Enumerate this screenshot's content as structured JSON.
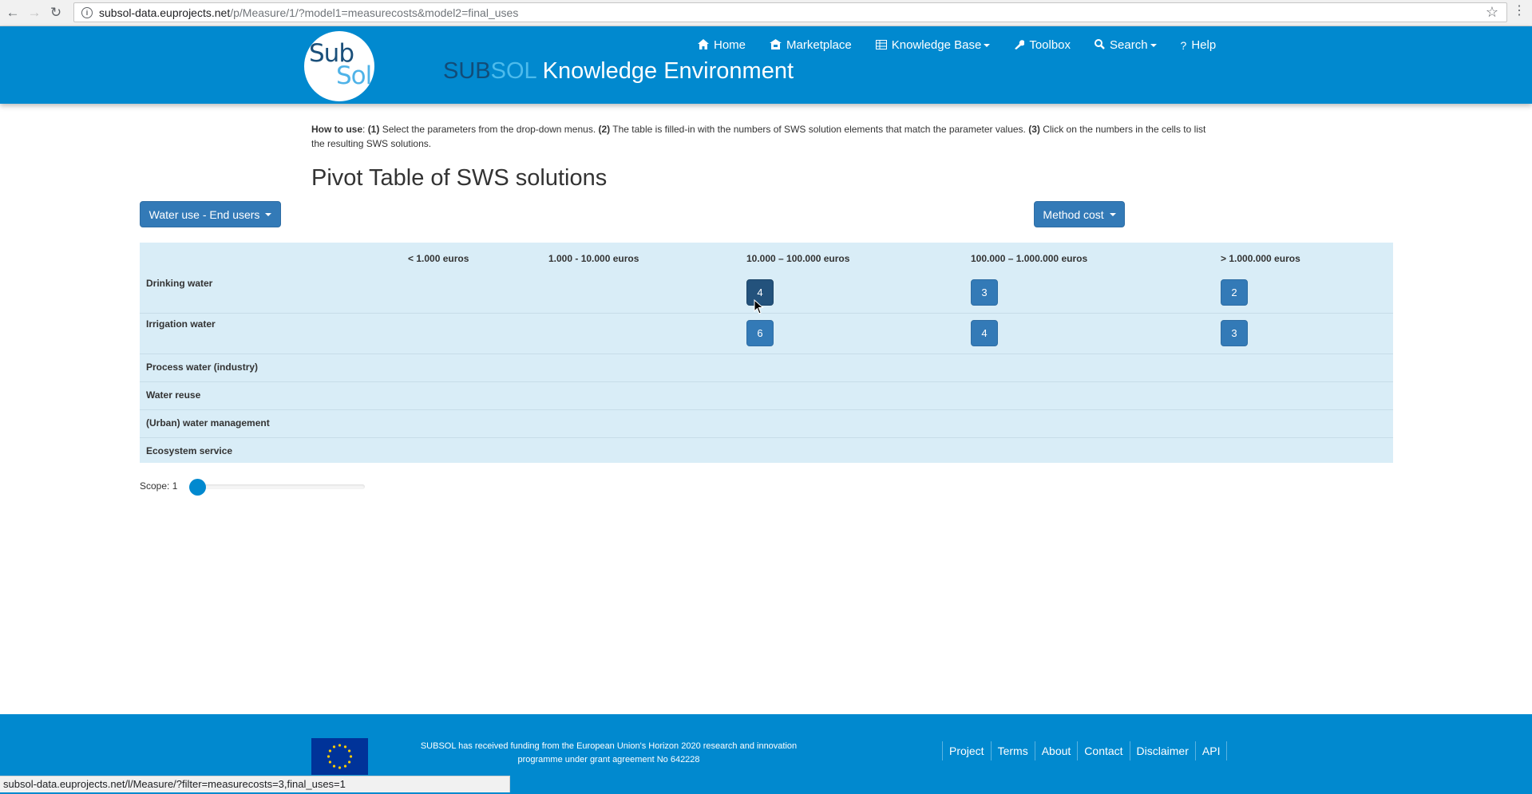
{
  "browser": {
    "url_domain": "subsol-data.euprojects.net",
    "url_path": "/p/Measure/1/?model1=measurecosts&model2=final_uses",
    "status_url": "subsol-data.euprojects.net/l/Measure/?filter=measurecosts=3,final_uses=1"
  },
  "header": {
    "logo_sub": "Sub",
    "logo_sol": "Sol",
    "title_sub": "SUB",
    "title_sol": "SOL",
    "title_rest": " Knowledge Environment",
    "nav": [
      {
        "label": "Home",
        "icon": "home-icon"
      },
      {
        "label": "Marketplace",
        "icon": "shop-icon"
      },
      {
        "label": "Knowledge Base",
        "icon": "table-icon",
        "dropdown": true
      },
      {
        "label": "Toolbox",
        "icon": "wrench-icon"
      },
      {
        "label": "Search",
        "icon": "search-icon",
        "dropdown": true
      },
      {
        "label": "Help",
        "icon": "question-icon"
      }
    ]
  },
  "howto": {
    "label": "How to use",
    "step1_num": "(1)",
    "step1": " Select the parameters from the drop-down menus. ",
    "step2_num": "(2)",
    "step2": " The table is filled-in with the numbers of SWS solution elements that match the parameter values. ",
    "step3_num": "(3)",
    "step3": " Click on the numbers in the cells to list the resulting SWS solutions."
  },
  "page_title": "Pivot Table of SWS solutions",
  "model1_button": "Water use - End users",
  "model2_button": "Method cost",
  "pivot": {
    "columns": [
      "< 1.000 euros",
      "1.000 - 10.000 euros",
      "10.000 – 100.000 euros",
      "100.000 – 1.000.000 euros",
      "> 1.000.000 euros"
    ],
    "rows": [
      {
        "label": "Drinking water",
        "cells": [
          "",
          "",
          "4",
          "3",
          "2"
        ]
      },
      {
        "label": "Irrigation water",
        "cells": [
          "",
          "",
          "6",
          "4",
          "3"
        ]
      },
      {
        "label": "Process water (industry)",
        "cells": [
          "",
          "",
          "",
          "",
          ""
        ]
      },
      {
        "label": "Water reuse",
        "cells": [
          "",
          "",
          "",
          "",
          ""
        ]
      },
      {
        "label": "(Urban) water management",
        "cells": [
          "",
          "",
          "",
          "",
          ""
        ]
      },
      {
        "label": "Ecosystem service",
        "cells": [
          "",
          "",
          "",
          "",
          ""
        ]
      }
    ]
  },
  "scope": {
    "label": "Scope: 1",
    "value": 1
  },
  "footer": {
    "funding_text": "SUBSOL has received funding from the European Union's Horizon 2020 research and innovation programme under grant agreement No 642228",
    "links": [
      "Project",
      "Terms",
      "About",
      "Contact",
      "Disclaimer",
      "API"
    ]
  },
  "colors": {
    "header_bg": "#0189cf",
    "button": "#337ab7",
    "table_bg": "#d9edf7"
  }
}
